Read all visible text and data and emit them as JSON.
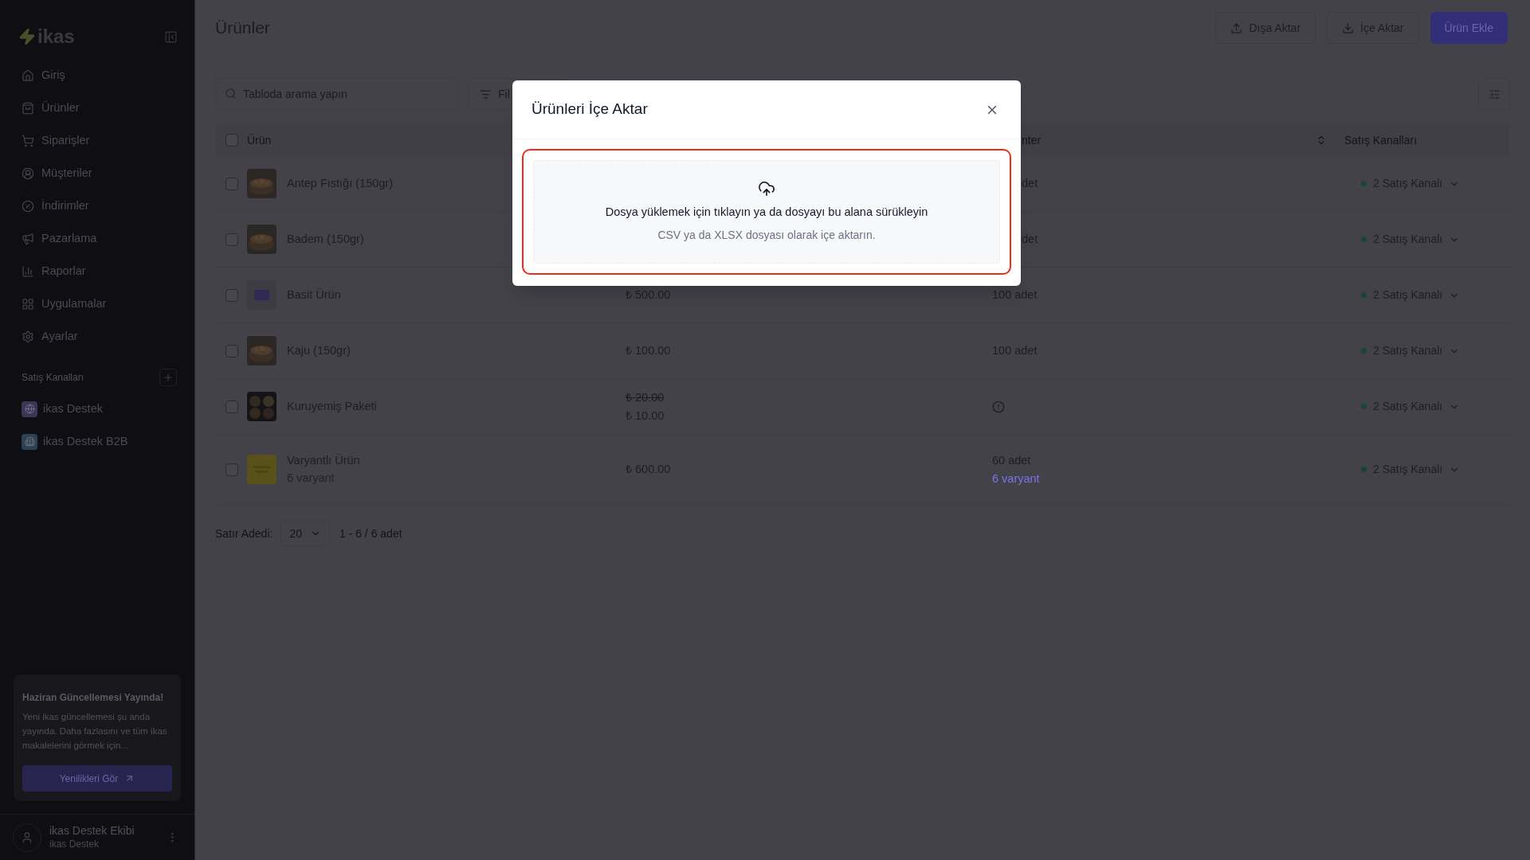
{
  "sidebar": {
    "logo": "ikas",
    "items": [
      {
        "label": "Giriş"
      },
      {
        "label": "Ürünler"
      },
      {
        "label": "Siparişler"
      },
      {
        "label": "Müşteriler"
      },
      {
        "label": "İndirimler"
      },
      {
        "label": "Pazarlama"
      },
      {
        "label": "Raporlar"
      },
      {
        "label": "Uygulamalar"
      },
      {
        "label": "Ayarlar"
      }
    ],
    "channels_heading": "Satış Kanalları",
    "channels": [
      {
        "label": "ikas Destek",
        "color": "#3b3558"
      },
      {
        "label": "ikas Destek B2B",
        "color": "#2e4150"
      }
    ],
    "update_card": {
      "title": "Haziran Güncellemesi Yayında!",
      "text": "Yeni ikas güncellemesi şu anda yayında. Daha fazlasını ve tüm ikas makalelerini görmek için...",
      "button": "Yenilikleri Gör"
    },
    "user": {
      "name": "ikas Destek Ekibi",
      "org": "ikas Destek"
    }
  },
  "header": {
    "title": "Ürünler",
    "buttons": [
      {
        "kind": "export",
        "label": "Dışa Aktar"
      },
      {
        "kind": "import",
        "label": "İçe Aktar"
      },
      {
        "kind": "primary",
        "label": "Ürün Ekle"
      }
    ]
  },
  "toolbar": {
    "search": {
      "placeholder": "Tabloda arama yapın"
    },
    "filter": "Fil"
  },
  "table": {
    "select_all": {
      "checked": false
    },
    "columns": [
      "Ürün",
      "nter",
      "Satış Kanalları"
    ],
    "rows": [
      {
        "checked": false,
        "name": "Antep Fıstığı (150gr)",
        "stock": "det",
        "channels": "2 Satış Kanalı"
      },
      {
        "checked": false,
        "name": "Badem (150gr)",
        "stock": "det",
        "channels": "2 Satış Kanalı"
      },
      {
        "checked": false,
        "name": "Basit Ürün",
        "price": "₺ 500.00",
        "stock": "100 adet",
        "channels": "2 Satış Kanalı"
      },
      {
        "checked": false,
        "name": "Kaju (150gr)",
        "price": "₺ 100.00",
        "stock": "100 adet",
        "channels": "2 Satış Kanalı"
      },
      {
        "checked": false,
        "name": "Kuruyemiş Paketi",
        "old_price": "₺ 20.00",
        "price": "₺ 10.00",
        "stock_warning": true,
        "channels": "2 Satış Kanalı"
      },
      {
        "checked": false,
        "name": "Varyantlı Ürün",
        "subtitle": "6 varyant",
        "price": "₺ 600.00",
        "stock": "60 adet",
        "stock_link": "6 varyant",
        "channels": "2 Satış Kanalı"
      }
    ]
  },
  "pagination": {
    "label": "Satır Adedi:",
    "page_size": "20",
    "range": "1 - 6 / 6 adet"
  },
  "modal": {
    "title": "Ürünleri İçe Aktar",
    "dropzone": {
      "text": "Dosya yüklemek için tıklayın ya da dosyayı bu alana sürükleyin",
      "hint": "CSV ya da XLSX dosyası olarak içe aktarın."
    }
  }
}
